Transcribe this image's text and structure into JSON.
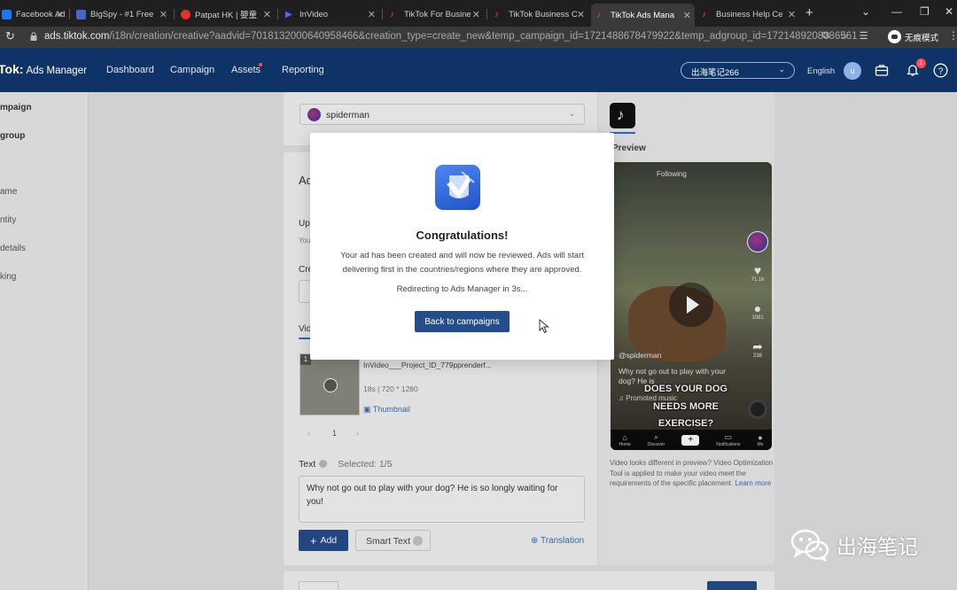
{
  "browser": {
    "tabs": [
      {
        "title": "Facebook Ad",
        "color": "#1877f2"
      },
      {
        "title": "BigSpy - #1 Free",
        "color": "#4866c8"
      },
      {
        "title": "Patpat HK | 嬰童",
        "color": "#e0322c"
      },
      {
        "title": "InVideo",
        "color": "#4a6cf7"
      },
      {
        "title": "TikTok For Busine",
        "color": "#222222"
      },
      {
        "title": "TikTok Business C",
        "color": "#222222"
      },
      {
        "title": "TikTok Ads Mana",
        "color": "#222222"
      },
      {
        "title": "Business Help Ce",
        "color": "#222222"
      }
    ],
    "url_host": "ads.tiktok.com",
    "url_path": "/i18n/creation/creative?aadvid=7018132000640958466&creation_type=create_new&temp_campaign_id=1721488678479922&temp_adgroup_id=1721489208386561",
    "incognito_label": "无痕模式"
  },
  "header": {
    "logo": "Tok:",
    "logo_sub": "Ads Manager",
    "nav": [
      "Dashboard",
      "Campaign",
      "Assets",
      "Reporting"
    ],
    "account": "出海笔记266",
    "language": "English",
    "user_initial": "u",
    "notification_count": "1"
  },
  "sidebar": {
    "items": [
      "mpaign",
      "group",
      "ame",
      "ntity",
      "details",
      "king"
    ]
  },
  "form": {
    "identity_value": "spiderman",
    "video": {
      "index": "1",
      "name": "InVideo___Project_ID_779pprenderf...",
      "meta": "18s | 720 * 1280",
      "thumbnail_label": "Thumbnail"
    },
    "pager": {
      "prev": "‹",
      "page": "1",
      "next": "›"
    },
    "text_label": "Text",
    "text_selected": "Selected: 1/5",
    "text_value": "Why not go out to play with your dog? He is so longly waiting for you!",
    "add_label": "Add",
    "smart_text_label": "Smart Text",
    "translation_label": "Translation"
  },
  "preview": {
    "label": "Preview",
    "following": "Following",
    "username": "@spiderman",
    "caption": "Why not go out to play with your dog? He is",
    "promoted": "Promoted music",
    "overlay_lines": [
      "DOES YOUR DOG",
      "NEEDS MORE",
      "EXERCISE?"
    ],
    "likes": "71.1k",
    "comments": "1081",
    "shares": "238",
    "nav": [
      "Home",
      "Discover",
      "+",
      "Notifications",
      "Me"
    ],
    "note": "Video looks different in preview? Video Optimization Tool is applied to make your video meet the requirements of the specific placement.",
    "note_link": "Learn more"
  },
  "modal": {
    "title": "Congratulations!",
    "body": "Your ad has been created and will now be reviewed. Ads will start delivering first in the countries/regions where they are approved.",
    "redirect": "Redirecting to Ads Manager in 3s...",
    "button": "Back to campaigns"
  },
  "watermark": "出海笔记",
  "colors": {
    "header_bg": "#0f3267",
    "primary_button": "#244d8b",
    "link": "#3a6fb8",
    "badge": "#ff4d4f"
  }
}
